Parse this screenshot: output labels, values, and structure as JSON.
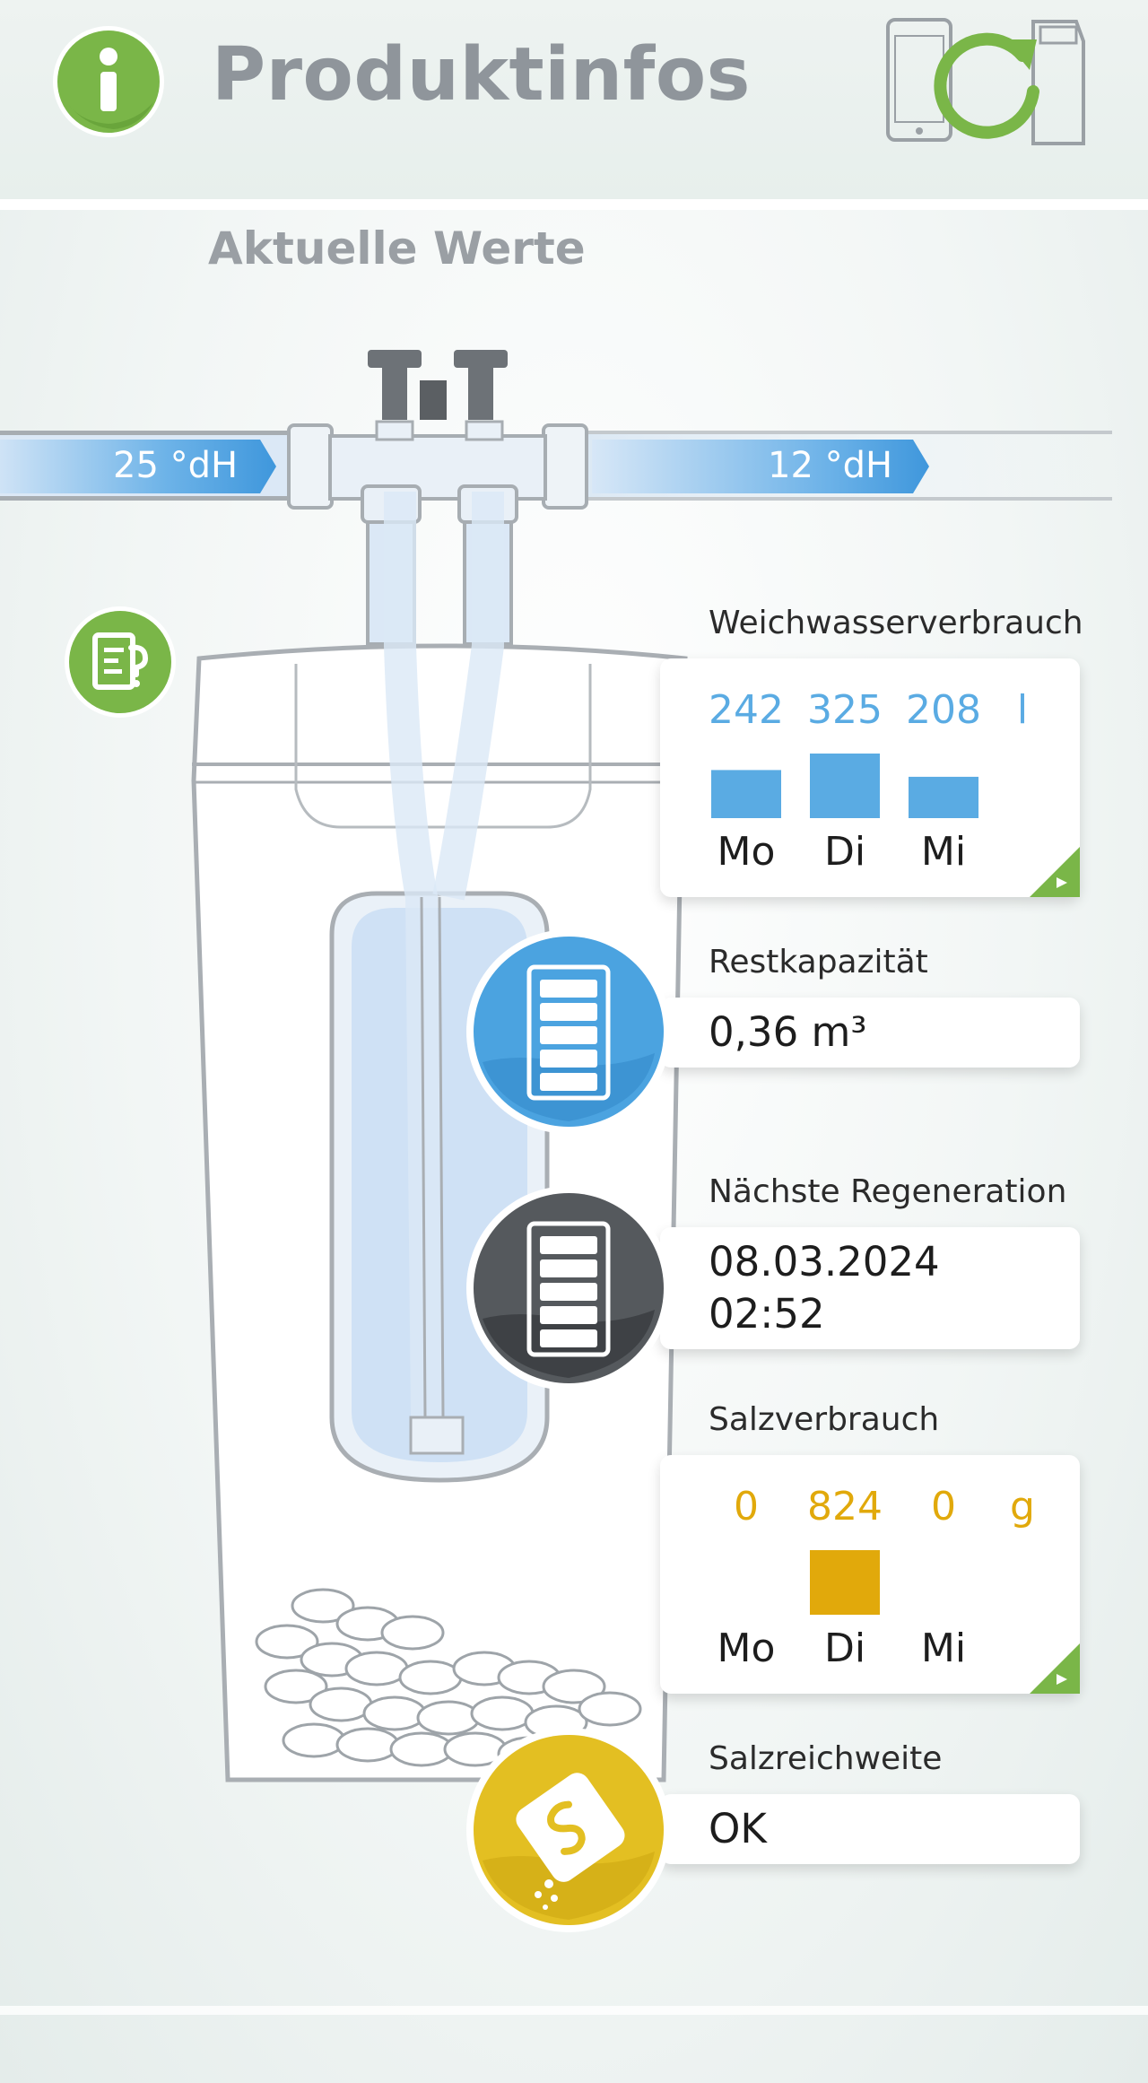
{
  "header": {
    "title": "Produktinfos",
    "subtitle": "Aktuelle Werte",
    "info_icon": "info-icon",
    "sync_icon": "device-sync-icon"
  },
  "pipes": {
    "inlet_hardness": "25 °dH",
    "outlet_hardness": "12 °dH"
  },
  "help_icon": "document-question-icon",
  "colors": {
    "brand_green": "#7ab648",
    "water_blue": "#5aabe3",
    "salt_yellow": "#e1a90b",
    "dark_gray": "#4f5357"
  },
  "soft_water": {
    "label": "Weichwasserverbrauch",
    "unit": "l",
    "chart_data": {
      "type": "bar",
      "categories": [
        "Mo",
        "Di",
        "Mi"
      ],
      "values": [
        242,
        325,
        208
      ],
      "value_labels": [
        "242",
        "325",
        "208"
      ],
      "color": "#5aabe3"
    }
  },
  "capacity": {
    "label": "Restkapazität",
    "value": "0,36 m³",
    "icon": "water-level-icon"
  },
  "regeneration": {
    "label": "Nächste Regeneration",
    "date": "08.03.2024",
    "time": "02:52",
    "icon": "regeneration-level-icon"
  },
  "salt_usage": {
    "label": "Salzverbrauch",
    "unit": "g",
    "chart_data": {
      "type": "bar",
      "categories": [
        "Mo",
        "Di",
        "Mi"
      ],
      "values": [
        0,
        824,
        0
      ],
      "value_labels": [
        "0",
        "824",
        "0"
      ],
      "color": "#e1a90b"
    }
  },
  "salt_range": {
    "label": "Salzreichweite",
    "value": "OK",
    "icon": "salt-bag-icon"
  }
}
